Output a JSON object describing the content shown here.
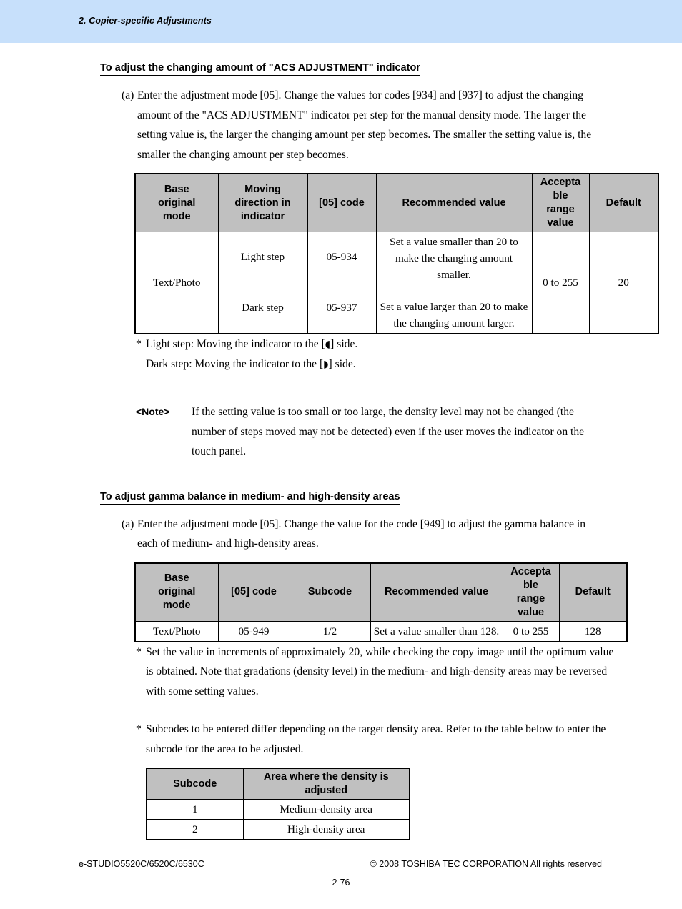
{
  "header": {
    "chapter_title": "2. Copier-specific Adjustments"
  },
  "sections": [
    {
      "heading": "To adjust the changing amount of \"ACS ADJUSTMENT\" indicator",
      "paragraph_marker": "(a)",
      "paragraph": "Enter the adjustment mode [05]. Change the values for codes [934] and [937] to adjust the changing amount of the \"ACS ADJUSTMENT\" indicator per step for the manual density mode. The larger the setting value is, the larger the changing amount per step becomes. The smaller the setting value is, the smaller the changing amount per step becomes."
    },
    {
      "heading": "To adjust gamma balance in medium- and high-density areas",
      "paragraph_marker": "(a)",
      "paragraph": "Enter the adjustment mode [05]. Change the value for the code [949] to adjust the gamma balance in each of medium- and high-density areas."
    }
  ],
  "table1": {
    "headers": {
      "base_original_mode": "Base\noriginal\nmode",
      "base_original_mode_l1": "Base",
      "base_original_mode_l2": "original",
      "base_original_mode_l3": "mode",
      "moving_direction_l1": "Moving",
      "moving_direction_l2": "direction in",
      "moving_direction_l3": "indicator",
      "code": "[05] code",
      "recommended_value": "Recommended value",
      "acceptable_range_l1": "Accepta",
      "acceptable_range_l2": "ble",
      "acceptable_range_l3": "range",
      "acceptable_range_l4": "value",
      "default": "Default"
    },
    "rows": [
      {
        "base_original_mode": "Text/Photo",
        "moving_direction": "Light step",
        "code": "05-934",
        "recommended_value_1": "Set a value smaller than 20 to make the changing amount smaller.",
        "recommended_value_2": "Set a value larger than 20 to make the changing amount larger.",
        "acceptable_range_value": "0 to 255",
        "default": "20"
      },
      {
        "moving_direction": "Dark step",
        "code": "05-937"
      }
    ]
  },
  "table1_notes": {
    "light_step_prefix": "Light step: Moving the indicator to the [",
    "light_step_glyph": "◖",
    "light_step_suffix": "] side.",
    "dark_step_prefix": "Dark step: Moving the indicator to the [",
    "dark_step_glyph": "◗",
    "dark_step_suffix": "] side.",
    "star": "*"
  },
  "note": {
    "label": "<Note>",
    "text": "If the setting value is too small or too large, the density level may not be changed (the number of steps moved may not be detected) even if the user moves the indicator on the touch panel."
  },
  "table2": {
    "headers": {
      "base_original_mode_l1": "Base",
      "base_original_mode_l2": "original",
      "base_original_mode_l3": "mode",
      "code": "[05] code",
      "subcode": "Subcode",
      "recommended_value": "Recommended value",
      "acceptable_range_l1": "Accepta",
      "acceptable_range_l2": "ble",
      "acceptable_range_l3": "range",
      "acceptable_range_l4": "value",
      "default": "Default"
    },
    "rows": [
      {
        "base_original_mode": "Text/Photo",
        "code": "05-949",
        "subcode": "1/2",
        "recommended_value": "Set a value smaller than 128.",
        "acceptable_range_value": "0 to 255",
        "default": "128"
      }
    ]
  },
  "table2_notes": {
    "star": "*",
    "note_1": "Set the value in increments of approximately 20, while checking the copy image until the optimum value is obtained. Note that gradations (density level) in the medium- and high-density areas may be reversed with some setting values.",
    "note_2": "Subcodes to be entered differ depending on the target density area. Refer to the table below to enter the subcode for the area to be adjusted."
  },
  "table3": {
    "headers": {
      "subcode": "Subcode",
      "area_l1": "Area where the density is",
      "area_l2": "adjusted"
    },
    "rows": [
      {
        "subcode": "1",
        "area": "Medium-density area"
      },
      {
        "subcode": "2",
        "area": "High-density area"
      }
    ]
  },
  "footer": {
    "model": "e-STUDIO5520C/6520C/6530C",
    "copyright": "© 2008 TOSHIBA TEC CORPORATION All rights reserved",
    "page_number": "2-76"
  }
}
